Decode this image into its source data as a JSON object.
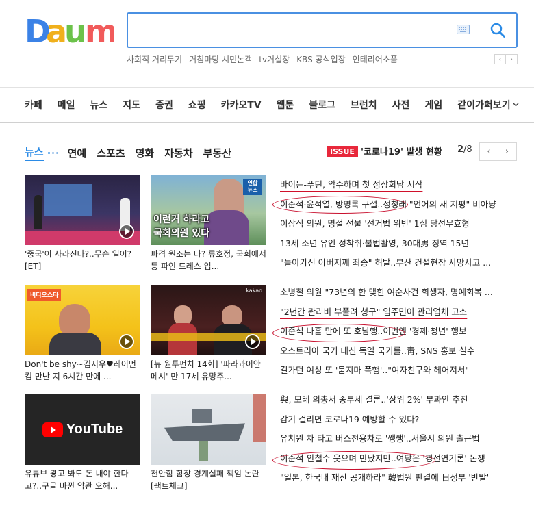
{
  "logo": {
    "text": "Daum"
  },
  "search": {
    "value": "",
    "placeholder": ""
  },
  "hotlinks": [
    "사회적 거리두기",
    "거침마당 시민논객",
    "tv거실장",
    "KBS 공식입장",
    "인테리어소품"
  ],
  "hot_pager": {
    "prev": "‹",
    "next": "›"
  },
  "services": [
    "카페",
    "메일",
    "뉴스",
    "지도",
    "증권",
    "쇼핑",
    "카카오TV",
    "웹툰",
    "블로그",
    "브런치",
    "사전",
    "게임",
    "같이가치"
  ],
  "services_more": "더보기",
  "news_tabs": {
    "active": "뉴스",
    "items": [
      "연예",
      "스포츠",
      "영화",
      "자동차",
      "부동산"
    ]
  },
  "issue": {
    "badge": "ISSUE",
    "text": "'코로나19' 발생 현황",
    "current": "2",
    "total": "/8",
    "prev": "‹",
    "next": "›"
  },
  "thumbs": [
    {
      "caption": "'중국'이 사라진다?..무슨 일이?[ET]",
      "video": true
    },
    {
      "caption": "파격 원조는 나? 류호정, 국회에서 등 파인 드레스 입...",
      "video": false,
      "overlay_top": "연합 뉴스",
      "overlay_main": "이런거 하라고 국회의원 있다"
    },
    {
      "caption": "Don't be shy~김지우♥레이먼킴 만난 지 6시간 만에 ...",
      "video": true,
      "overlay_top": "비디오스타"
    },
    {
      "caption": "[뉴 원투펀치 14회] '파라과이안 메시' 만 17세 유망주...",
      "video": true,
      "overlay_top": "kakao"
    },
    {
      "caption": "유튜브 광고 봐도 돈 내야 한다고?..구글 바뀐 약관 오해...",
      "video": false,
      "overlay_main": "YouTube"
    },
    {
      "caption": "천안함 함장 경계실패 책임 논란[팩트체크]",
      "video": false
    }
  ],
  "headlines": [
    [
      "바이든-푸틴, 악수하며 첫 정상회담 시작",
      "이준석·윤석열, 방명록 구설..정청래 \"언어의 새 지평\" 비아냥",
      "이상직 의원, 명절 선물 '선거법 위반' 1심 당선무효형",
      "13세 소년 유인 성착취·불법촬영, 30대男 징역 15년",
      "\"돌아가신 아버지께 죄송\" 허탈..부산 건설현장 사망사고 ..."
    ],
    [
      "소병철 의원 \"73년의 한 맺힌 여순사건 희생자, 명예회복 ...",
      "\"2년간 관리비 부풀려 청구\" 입주민이 관리업체 고소",
      "이준석 나흘 만에 또 호남행..이번엔 '경제·청년' 행보",
      "오스트리아 국기 대신 독일 국기를..靑, SNS 홍보 실수",
      "길가던 여성 또 '묻지마 폭행'..\"여자친구와 헤어져서\""
    ],
    [
      "與, 모레 의총서 종부세 결론..'상위 2%' 부과안 추진",
      "감기 걸리면 코로나19 예방할 수 있다?",
      "유치원 차 타고 버스전용차로 '쌩쌩'..서울시 의원 출근법",
      "이준석-안철수 웃으며 만났지만..여당은 '경선연기론' 논쟁",
      "\"일본, 한국내 재산 공개하라\" 韓법원 판결에 日정부 '반발'"
    ]
  ],
  "colors": {
    "accent": "#2b8be6",
    "issue": "#e8283b",
    "search_border": "#4a90e2",
    "annotation": "#c8102e"
  }
}
